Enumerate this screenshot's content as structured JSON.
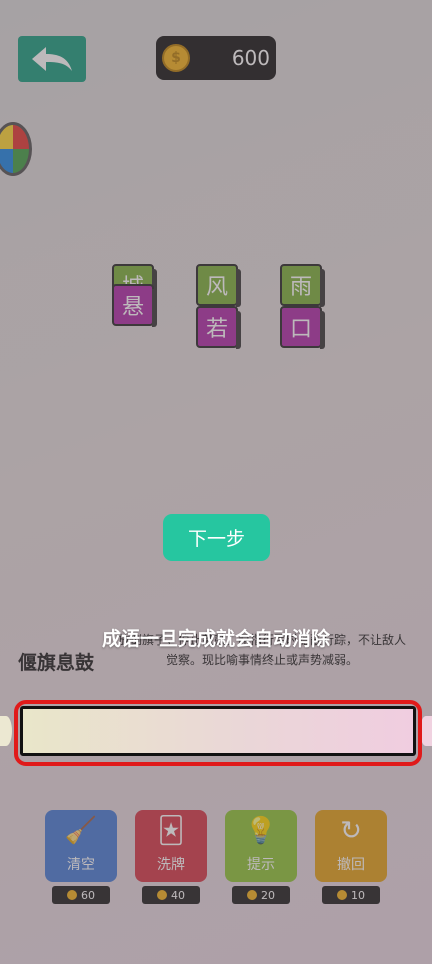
{
  "header": {
    "coins": "600",
    "coin_symbol": "$"
  },
  "tiles": [
    {
      "back": "城",
      "front": "悬"
    },
    {
      "back": "风",
      "front": "若"
    },
    {
      "back": "雨",
      "front": "口"
    }
  ],
  "buttons": {
    "next": "下一步"
  },
  "idiom": {
    "title": "偃旗息鼓",
    "description": "放倒旗子，停止敲鼓。原指行军时隐蔽行踪，不让敌人觉察。现比喻事情终止或声势减弱。"
  },
  "tip": "成语一旦完成就会自动消除",
  "tools": [
    {
      "label": "清空",
      "cost": "60",
      "color": "#4a7ed6",
      "icon": "broom-icon"
    },
    {
      "label": "洗牌",
      "cost": "40",
      "color": "#d63b4a",
      "icon": "cards-icon"
    },
    {
      "label": "提示",
      "cost": "20",
      "color": "#8fc53a",
      "icon": "lightbulb-icon"
    },
    {
      "label": "撤回",
      "cost": "10",
      "color": "#e3a21c",
      "icon": "undo-icon"
    }
  ]
}
